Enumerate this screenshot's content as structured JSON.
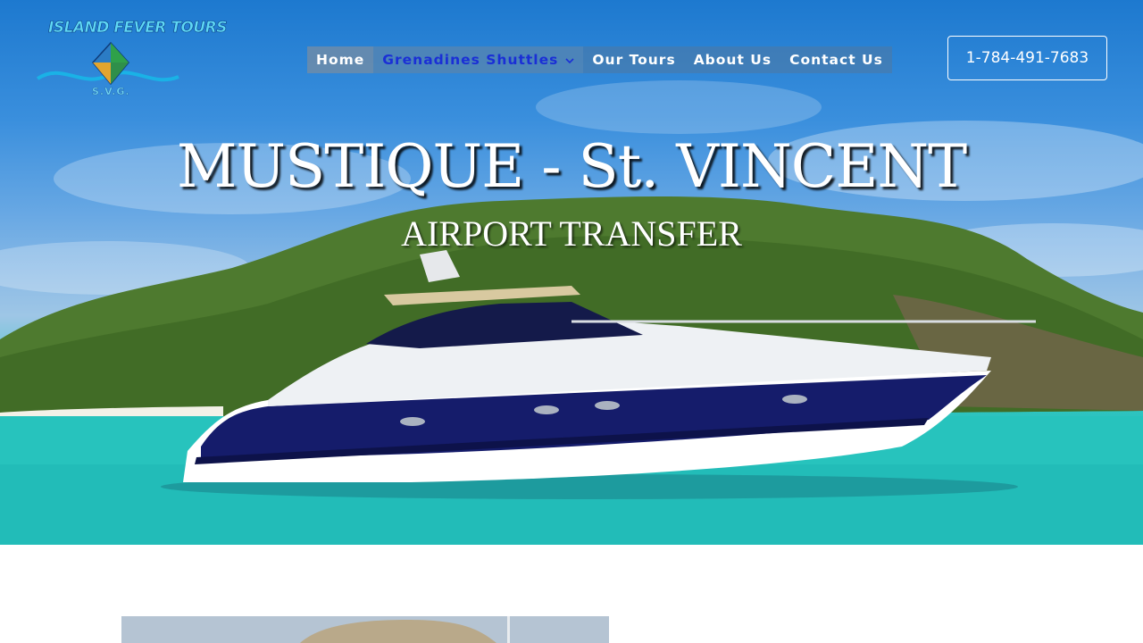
{
  "logo": {
    "text": "ISLAND FEVER TOURS",
    "subtext": "S.V.G."
  },
  "nav": {
    "items": [
      {
        "label": "Home"
      },
      {
        "label": "Grenadines Shuttles",
        "icon": "chevron-down-icon"
      },
      {
        "label": "Our Tours"
      },
      {
        "label": "About Us"
      },
      {
        "label": "Contact Us"
      }
    ],
    "active_color": "#1a2fd6"
  },
  "header": {
    "phone": "1-784-491-7683"
  },
  "hero": {
    "title": "MUSTIQUE - St. VINCENT",
    "subtitle": "AIRPORT TRANSFER"
  }
}
